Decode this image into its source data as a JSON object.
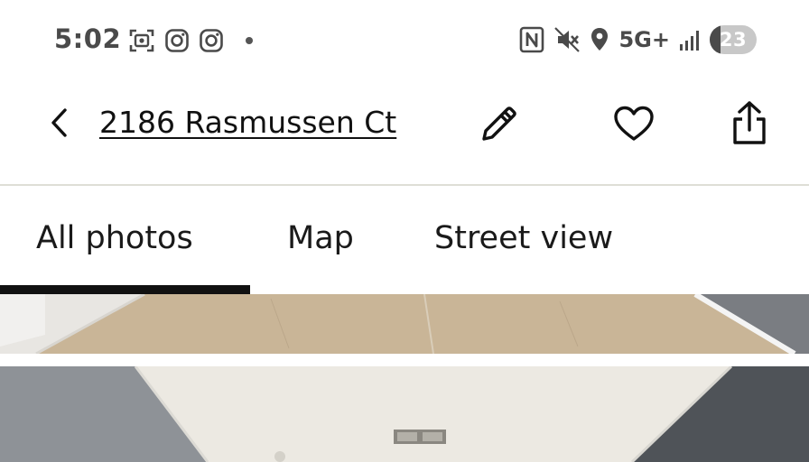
{
  "status_bar": {
    "time": "5:02",
    "network": "5G+",
    "battery": "23",
    "battery_level_percent": 23,
    "left_icons": [
      "screenshot-icon",
      "instagram-icon",
      "instagram-icon",
      "notification-dot"
    ],
    "right_icons": [
      "nfc-icon",
      "vibrate-mute-icon",
      "location-icon",
      "signal-icon",
      "battery-icon"
    ]
  },
  "header": {
    "address": "2186 Rasmussen Ct",
    "icons": [
      "back-arrow-icon",
      "pencil-icon",
      "heart-icon",
      "share-icon"
    ]
  },
  "tabs": [
    {
      "label": "All photos",
      "active": true
    },
    {
      "label": "Map",
      "active": false
    },
    {
      "label": "Street view",
      "active": false
    }
  ],
  "colors": {
    "text_primary": "#111111",
    "status_text": "#4a4a4a",
    "divider": "#deded6",
    "tab_indicator": "#111111"
  }
}
